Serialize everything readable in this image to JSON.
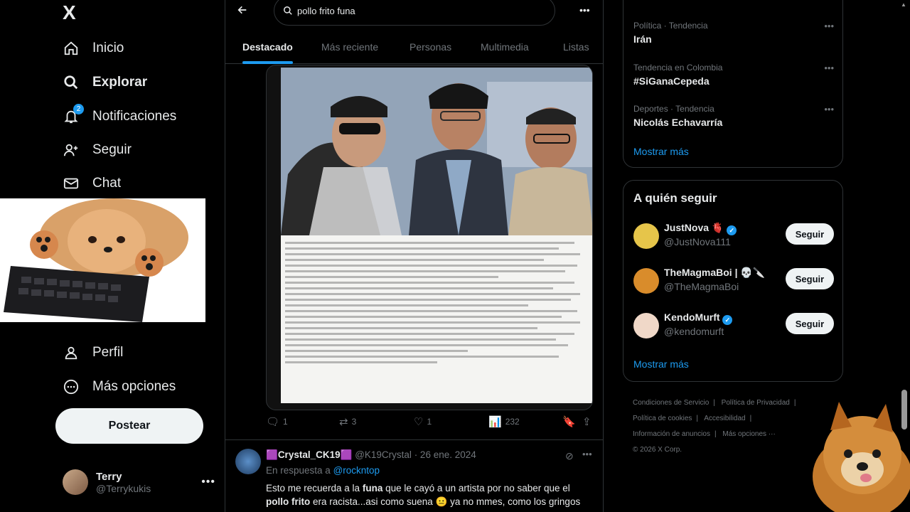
{
  "nav": {
    "logo": "X",
    "items": [
      {
        "label": "Inicio",
        "icon": "home-icon"
      },
      {
        "label": "Explorar",
        "icon": "search-icon"
      },
      {
        "label": "Notificaciones",
        "icon": "bell-icon",
        "badge": "2"
      },
      {
        "label": "Seguir",
        "icon": "follow-icon"
      },
      {
        "label": "Chat",
        "icon": "mail-icon"
      },
      {
        "label": "Perfil",
        "icon": "person-icon"
      },
      {
        "label": "Más opciones",
        "icon": "more-circle-icon"
      }
    ],
    "post_label": "Postear"
  },
  "account": {
    "name": "Terry",
    "handle": "@Terrykukis"
  },
  "search": {
    "value": "pollo frito funa"
  },
  "tabs": [
    {
      "label": "Destacado",
      "active": true
    },
    {
      "label": "Más reciente"
    },
    {
      "label": "Personas"
    },
    {
      "label": "Multimedia"
    },
    {
      "label": "Listas"
    }
  ],
  "tweet1": {
    "replies": "1",
    "reposts": "3",
    "likes": "1",
    "views": "232"
  },
  "tweet2": {
    "name": "Crystal_CK19",
    "handle": "@K19Crystal",
    "date": "· 26 ene. 2024",
    "reply_prefix": "En respuesta a",
    "reply_to": "@rockntop",
    "text_1": "Esto me recuerda a la ",
    "text_b1": "funa",
    "text_2": " que le cayó a un artista por no saber que el ",
    "text_b2": "pollo frito",
    "text_3": " era racista...asi como suena 😐 ya no mmes, como los gringos se"
  },
  "trends": [
    {
      "meta": "Política · Tendencia",
      "name": "Irán"
    },
    {
      "meta": "Tendencia en Colombia",
      "name": "#SiGanaCepeda"
    },
    {
      "meta": "Deportes · Tendencia",
      "name": "Nicolás Echavarría"
    }
  ],
  "trends_show_more": "Mostrar más",
  "who_to_follow": {
    "title": "A quién seguir",
    "users": [
      {
        "name": "JustNova 🫀",
        "handle": "@JustNova111",
        "verified": true,
        "avatar_color": "#e6c54a"
      },
      {
        "name": "TheMagmaBoi | 💀🔪",
        "handle": "@TheMagmaBoi",
        "verified": false,
        "avatar_color": "#d98c2b"
      },
      {
        "name": "KendoMurft",
        "handle": "@kendomurft",
        "verified": true,
        "avatar_color": "#f0d8c8"
      }
    ],
    "follow_label": "Seguir",
    "show_more": "Mostrar más"
  },
  "footer": {
    "links": [
      "Condiciones de Servicio",
      "Política de Privacidad",
      "Política de cookies",
      "Accesibilidad",
      "Información de anuncios",
      "Más opciones ···"
    ],
    "copyright": "© 2026 X Corp."
  }
}
